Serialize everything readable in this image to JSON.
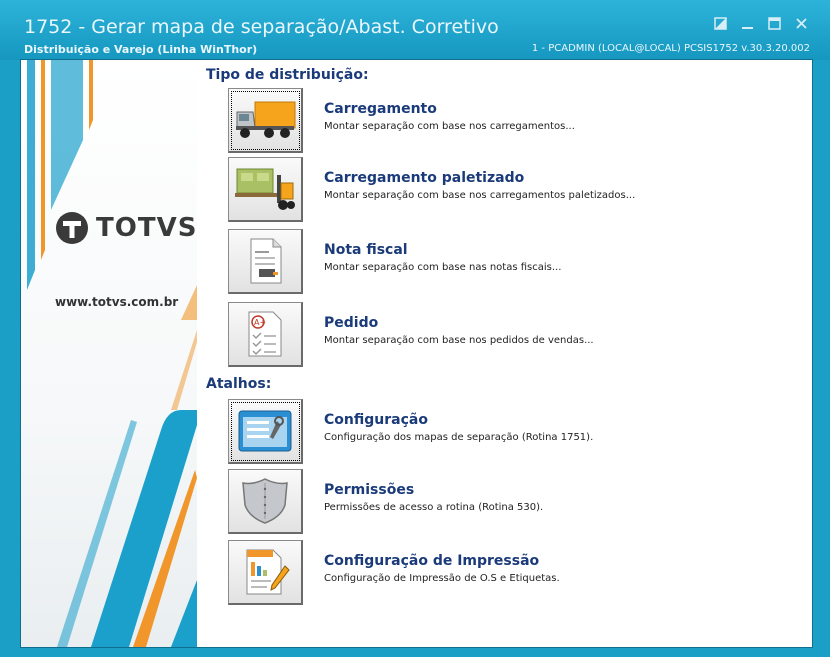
{
  "window": {
    "title": "1752 - Gerar mapa de separação/Abast. Corretivo",
    "subtitle": "Distribuição e Varejo (Linha WinThor)",
    "session": "1 - PCADMIN (LOCAL@LOCAL)   PCSIS1752  v.30.3.20.002",
    "buttons": [
      "restore-icon",
      "minimize-icon",
      "maximize-icon",
      "close-icon"
    ]
  },
  "sidebar": {
    "brand": "TOTVS",
    "website": "www.totvs.com.br"
  },
  "sections": {
    "distribution_title": "Tipo de distribuição:",
    "shortcuts_title": "Atalhos:"
  },
  "distribution": [
    {
      "label": "Carregamento",
      "desc": "Montar separação com base nos carregamentos...",
      "icon": "truck-icon"
    },
    {
      "label": "Carregamento paletizado",
      "desc": "Montar separação com base nos carregamentos paletizados...",
      "icon": "forklift-icon"
    },
    {
      "label": "Nota fiscal",
      "desc": "Montar separação com base nas notas fiscais...",
      "icon": "invoice-icon"
    },
    {
      "label": "Pedido",
      "desc": "Montar separação com base nos pedidos de vendas...",
      "icon": "checklist-icon"
    }
  ],
  "shortcuts": [
    {
      "label": "Configuração",
      "desc": "Configuração dos mapas de separação (Rotina 1751).",
      "icon": "settings-window-icon"
    },
    {
      "label": "Permissões",
      "desc": "Permissões de acesso a rotina (Rotina 530).",
      "icon": "shield-icon"
    },
    {
      "label": "Configuração de Impressão",
      "desc": "Configuração de Impressão de O.S e Etiquetas.",
      "icon": "print-config-icon"
    }
  ],
  "colors": {
    "frame": "#1c9fc6",
    "heading": "#1a3a7a",
    "stripe_blue": "#1b9fcb",
    "stripe_orange": "#f0962a"
  }
}
